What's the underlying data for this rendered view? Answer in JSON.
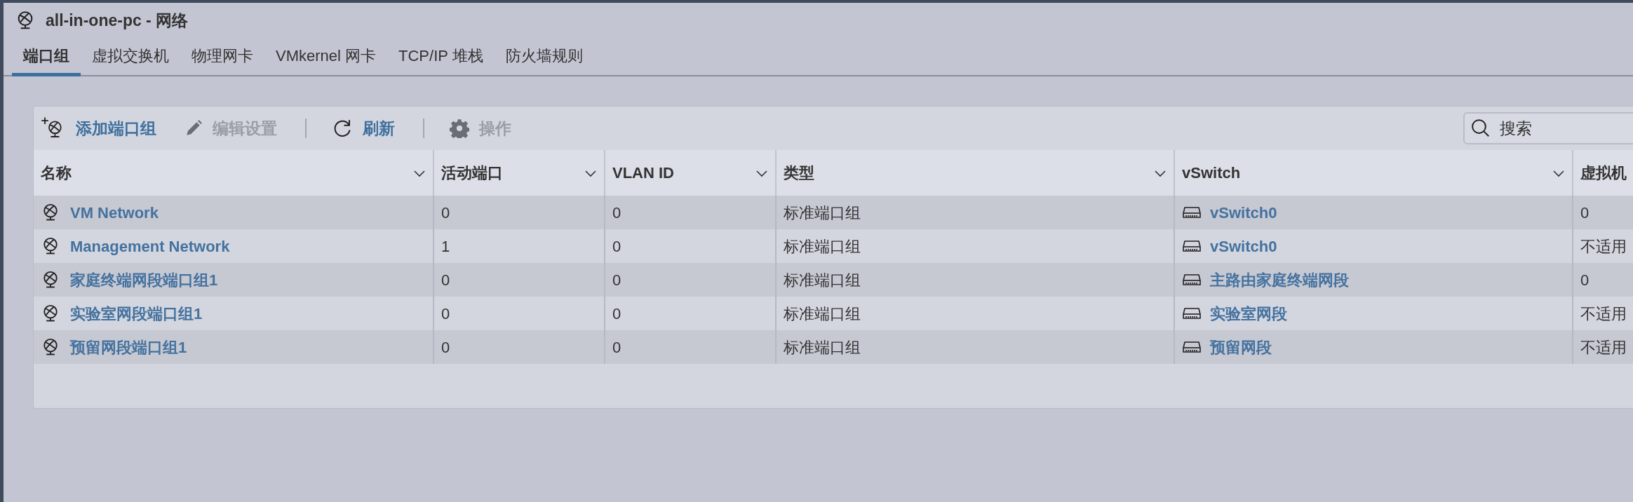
{
  "window": {
    "title": "all-in-one-pc - 网络"
  },
  "tabs": [
    {
      "label": "端口组",
      "selected": true
    },
    {
      "label": "虚拟交换机",
      "selected": false
    },
    {
      "label": "物理网卡",
      "selected": false
    },
    {
      "label": "VMkernel 网卡",
      "selected": false
    },
    {
      "label": "TCP/IP 堆栈",
      "selected": false
    },
    {
      "label": "防火墙规则",
      "selected": false
    }
  ],
  "toolbar": [
    {
      "kind": "add",
      "label": "添加端口组",
      "disabled": false
    },
    {
      "kind": "edit",
      "label": "编辑设置",
      "disabled": true
    },
    {
      "kind": "refresh",
      "label": "刷新",
      "disabled": false
    },
    {
      "kind": "actions",
      "label": "操作",
      "disabled": true
    }
  ],
  "search": {
    "placeholder": "搜索"
  },
  "table": {
    "columns": [
      "名称",
      "活动端口",
      "VLAN ID",
      "类型",
      "vSwitch",
      "虚拟机"
    ],
    "rows": [
      {
        "name": "VM Network",
        "active_ports": "0",
        "vlan_id": "0",
        "type": "标准端口组",
        "vswitch": "vSwitch0",
        "vms": "0"
      },
      {
        "name": "Management Network",
        "active_ports": "1",
        "vlan_id": "0",
        "type": "标准端口组",
        "vswitch": "vSwitch0",
        "vms": "不适用"
      },
      {
        "name": "家庭终端网段端口组1",
        "active_ports": "0",
        "vlan_id": "0",
        "type": "标准端口组",
        "vswitch": "主路由家庭终端网段",
        "vms": "0"
      },
      {
        "name": "实验室网段端口组1",
        "active_ports": "0",
        "vlan_id": "0",
        "type": "标准端口组",
        "vswitch": "实验室网段",
        "vms": "不适用"
      },
      {
        "name": "预留网段端口组1",
        "active_ports": "0",
        "vlan_id": "0",
        "type": "标准端口组",
        "vswitch": "预留网段",
        "vms": "不适用"
      }
    ]
  }
}
